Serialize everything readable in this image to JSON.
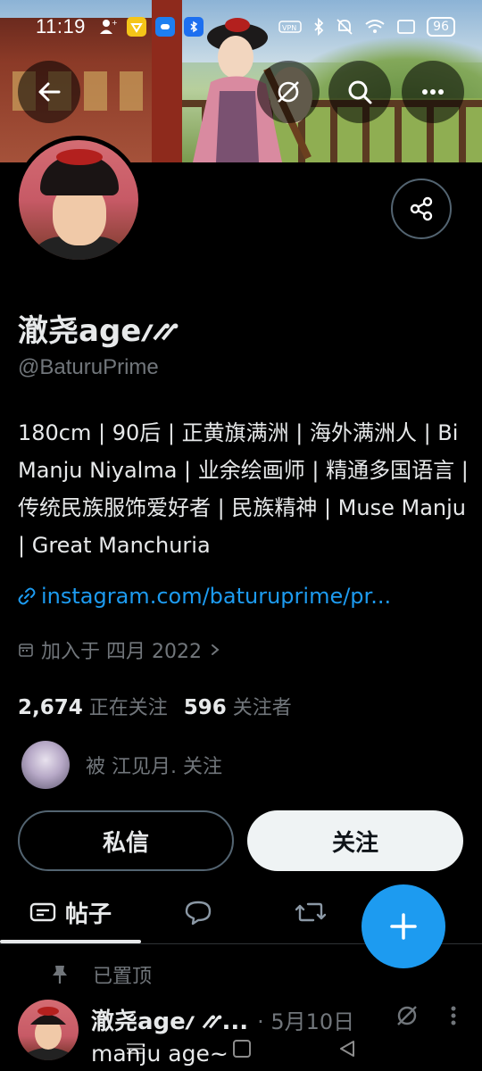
{
  "status_bar": {
    "time": "11:19",
    "battery": "96"
  },
  "profile": {
    "display_name": "澈尧ageⳇ⳼",
    "handle": "@BaturuPrime",
    "bio": "180cm | 90后 | 正黄旗满洲 | 海外满洲人 | Bi Manju Niyalma | 业余绘画师 | 精通多国语言 | 传统民族服饰爱好者 | 民族精神 | Muse Manju | Great Manchuria",
    "link": "instagram.com/baturuprime/pr...",
    "joined": "加入于 四月 2022",
    "following_count": "2,674",
    "following_label": "正在关注",
    "followers_count": "596",
    "followers_label": "关注者",
    "followed_by": "被 江见月. 关注"
  },
  "actions": {
    "dm_label": "私信",
    "follow_label": "关注"
  },
  "tabs": [
    {
      "label": "帖子",
      "active": true,
      "icon": "posts-icon"
    },
    {
      "label": "",
      "active": false,
      "icon": "reply-icon"
    },
    {
      "label": "",
      "active": false,
      "icon": "retweet-icon"
    }
  ],
  "pinned_post": {
    "pinned_label": "已置顶",
    "author": "澈尧ageⳇ ⳼...",
    "date": "· 5月10日",
    "text": "manju age~"
  },
  "colors": {
    "accent": "#1d9bf0",
    "background": "#000000",
    "text_primary": "#e7e9ea",
    "text_secondary": "#71767b",
    "border": "#536471"
  }
}
